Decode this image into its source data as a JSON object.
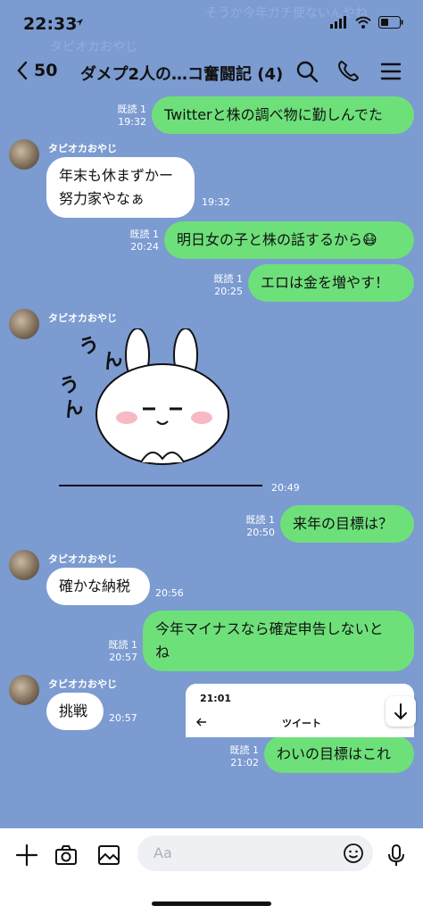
{
  "status_bar": {
    "time": "22:33"
  },
  "notification_bg": {
    "line1": "そうか今年ガチ使ないんやね",
    "line2": "タピオカおやじ"
  },
  "header": {
    "back_count": "50",
    "title": "ダメプ2人の…コ奮闘記 (4)",
    "icons": [
      "search-icon",
      "phone-icon",
      "menu-icon"
    ]
  },
  "messages": [
    {
      "from": "me",
      "text": "Twitterと株の調べ物に勤しんでた",
      "read": "既読 1",
      "time": "19:32"
    },
    {
      "from": "other",
      "sender": "タピオカおやじ",
      "text_lines": [
        "年末も休まずかー",
        "努力家やなぁ"
      ],
      "time": "19:32"
    },
    {
      "from": "me",
      "text": "明日女の子と株の話するから😷",
      "read": "既読 1",
      "time": "20:24"
    },
    {
      "from": "me",
      "text": "エロは金を増やす！",
      "read": "既読 1",
      "time": "20:25"
    },
    {
      "from": "other",
      "sender": "タピオカおやじ",
      "sticker": "うんうん",
      "time": "20:49"
    },
    {
      "from": "me",
      "text": "来年の目標は？",
      "read": "既読 1",
      "time": "20:50"
    },
    {
      "from": "other",
      "sender": "タピオカおやじ",
      "text": "確かな納税",
      "time": "20:56"
    },
    {
      "from": "me",
      "text_lines": [
        "今年マイナスなら確定申告しないと",
        "ね"
      ],
      "read": "既読 1",
      "time": "20:57"
    },
    {
      "from": "other",
      "sender": "タピオカおやじ",
      "text": "挑戦",
      "time": "20:57"
    },
    {
      "from": "me",
      "text": "わいの目標はこれ",
      "read": "既読 1",
      "time": "21:02"
    }
  ],
  "preview": {
    "time": "21:01",
    "title": "ツイート"
  },
  "composer": {
    "placeholder": "Aa",
    "icons": [
      "plus-icon",
      "camera-icon",
      "image-icon",
      "emoji-icon",
      "mic-icon"
    ]
  },
  "colors": {
    "background": "#7b9bd1",
    "my_bubble": "#6ee07a",
    "other_bubble": "#ffffff"
  }
}
